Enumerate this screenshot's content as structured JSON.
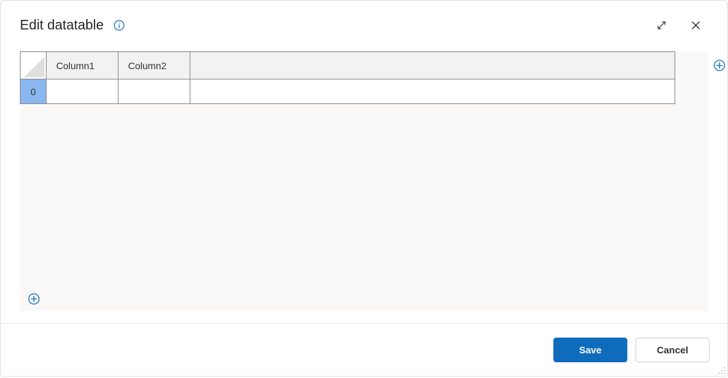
{
  "dialog": {
    "title": "Edit datatable"
  },
  "table": {
    "columns": [
      "Column1",
      "Column2",
      ""
    ],
    "rows": [
      {
        "index": "0",
        "cells": [
          "",
          "",
          ""
        ]
      }
    ]
  },
  "buttons": {
    "save": "Save",
    "cancel": "Cancel"
  },
  "colors": {
    "accent": "#0f6cbd",
    "row_header_selected": "#8bb7f0"
  }
}
